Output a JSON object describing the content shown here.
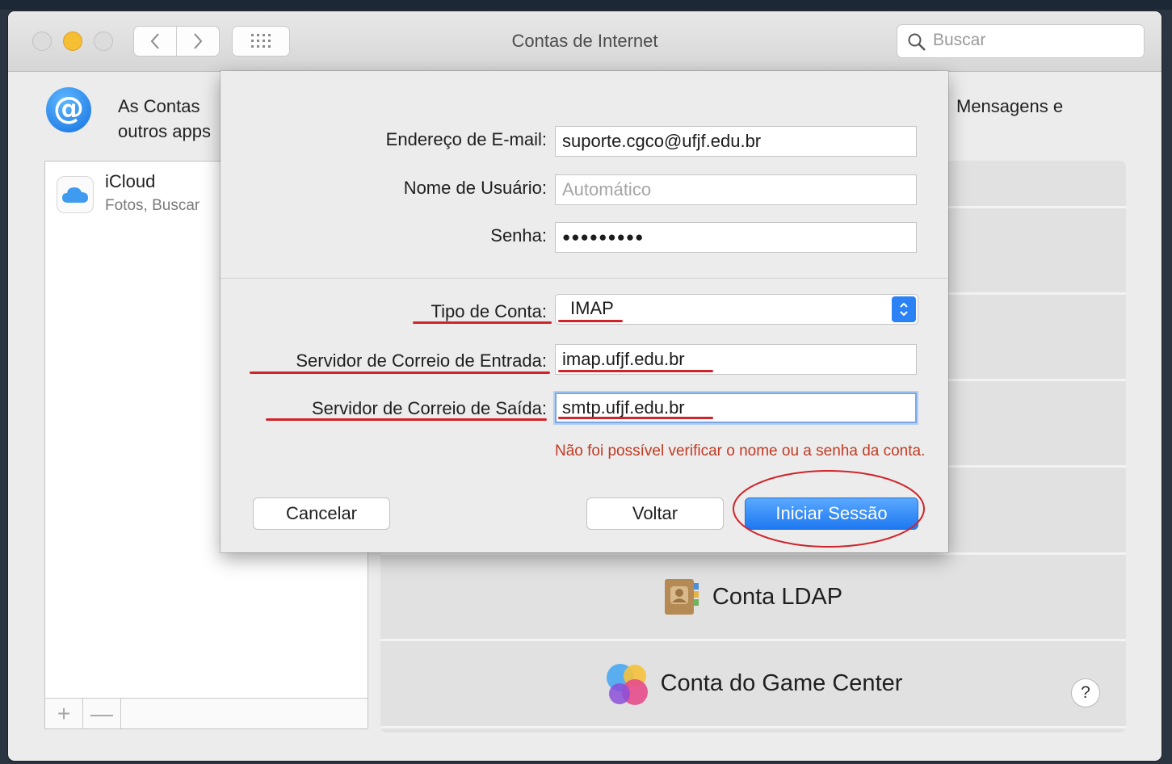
{
  "window": {
    "title": "Contas de Internet",
    "search_placeholder": "Buscar"
  },
  "header": {
    "text_line1_start": "As Contas",
    "text_line1_end": "Mensagens e",
    "text_line2_start": "outros apps"
  },
  "accounts": {
    "items": [
      {
        "name": "iCloud",
        "subtitle": "Fotos, Buscar"
      }
    ],
    "add_label": "+",
    "remove_label": "—"
  },
  "providers": {
    "items": [
      {
        "label": "Conta LDAP",
        "icon": "contacts-book-icon"
      },
      {
        "label": "Conta do Game Center",
        "icon": "game-center-icon"
      }
    ],
    "help_label": "?"
  },
  "sheet": {
    "email_label": "Endereço de E-mail:",
    "email_value": "suporte.cgco@ufjf.edu.br",
    "username_label": "Nome de Usuário:",
    "username_placeholder": "Automático",
    "password_label": "Senha:",
    "password_value": "●●●●●●●●●",
    "account_type_label": "Tipo de Conta:",
    "account_type_value": "IMAP",
    "incoming_label": "Servidor de Correio de Entrada:",
    "incoming_value": "imap.ufjf.edu.br",
    "outgoing_label": "Servidor de Correio de Saída:",
    "outgoing_value": "smtp.ufjf.edu.br",
    "error_message": "Não foi possível verificar o nome ou a senha da conta.",
    "cancel_label": "Cancelar",
    "back_label": "Voltar",
    "signin_label": "Iniciar Sessão"
  },
  "colors": {
    "accent": "#1e78f0",
    "error": "#c23a22",
    "annotation": "#d0242b"
  }
}
